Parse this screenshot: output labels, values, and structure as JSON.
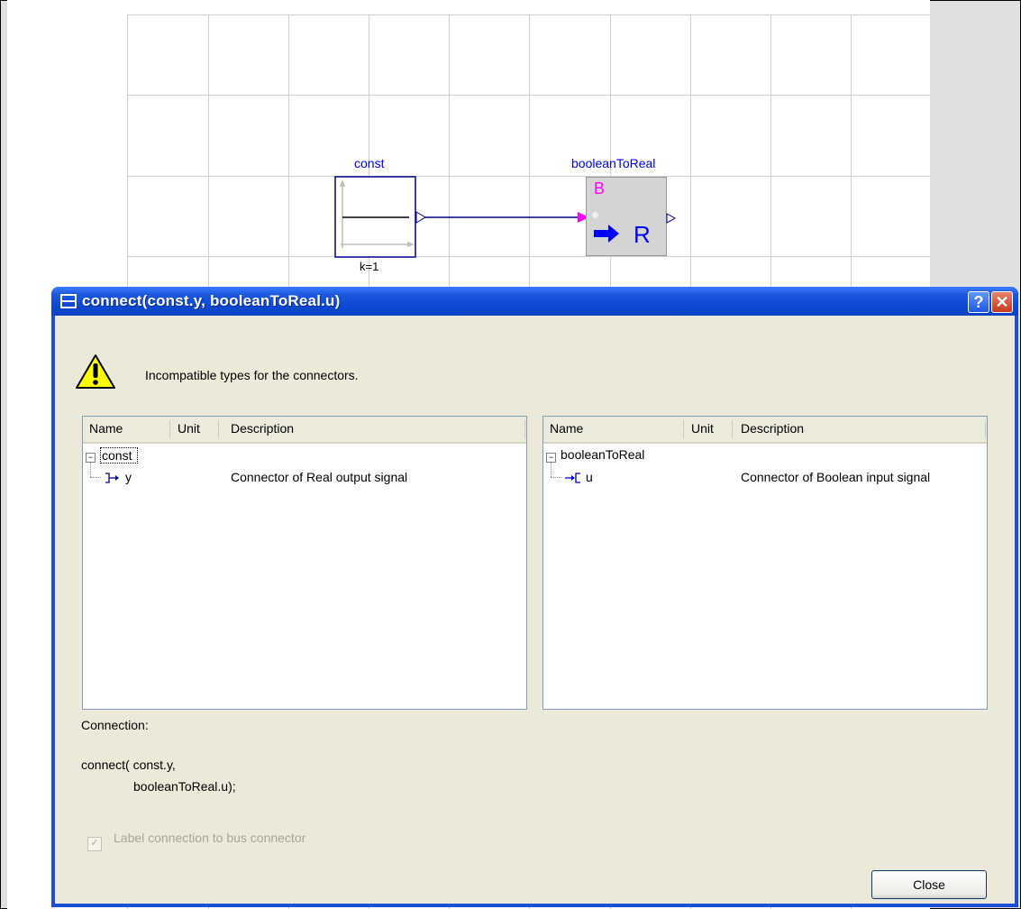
{
  "diagram": {
    "const_name": "const",
    "const_param": "k=1",
    "b2r_name": "booleanToReal",
    "b2r_in_letter": "B",
    "b2r_out_letter": "R"
  },
  "dialog": {
    "title": "connect(const.y, booleanToReal.u)",
    "help_label": "?",
    "close_glyph": "✕",
    "message": "Incompatible types for the connectors.",
    "left_tree": {
      "columns": [
        "Name",
        "Unit",
        "Description"
      ],
      "root": "const",
      "child_name": "y",
      "child_description": "Connector of Real output signal"
    },
    "right_tree": {
      "columns": [
        "Name",
        "Unit",
        "Description"
      ],
      "root": "booleanToReal",
      "child_name": "u",
      "child_description": "Connector of Boolean input signal"
    },
    "connection_label": "Connection:",
    "connection_code_line1": "connect( const.y,",
    "connection_code_line2": "booleanToReal.u);",
    "bus_checkbox_label": "Label connection to bus connector",
    "bus_checkbox_checked": true,
    "close_button_label": "Close"
  },
  "colors": {
    "titlebar": "#0a42c4",
    "wire": "#00008b",
    "label_blue": "#0000ff",
    "magenta": "#ff00ff"
  }
}
